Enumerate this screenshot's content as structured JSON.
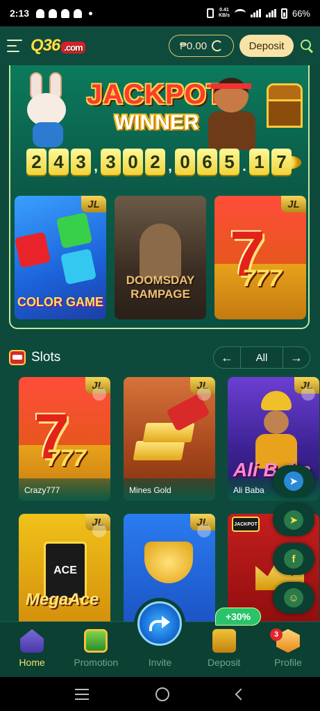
{
  "status_bar": {
    "time": "2:13",
    "net_speed_value": "0.41",
    "net_speed_unit": "KB/s",
    "battery": "66%"
  },
  "header": {
    "logo_main": "Q36",
    "logo_suffix": ".com",
    "balance": "₱0.00",
    "deposit_label": "Deposit"
  },
  "jackpot": {
    "title": "JACKPOT",
    "subtitle": "WINNER",
    "digits": [
      "2",
      "4",
      "3",
      ",",
      "3",
      "0",
      "2",
      ",",
      "0",
      "6",
      "5",
      ".",
      "1",
      "7"
    ],
    "games": [
      {
        "label": "COLOR GAME",
        "badge": "JL"
      },
      {
        "label": "DOOMSDAY RAMPAGE",
        "badge": "JL"
      },
      {
        "label": "777",
        "badge": "JL"
      }
    ]
  },
  "slots": {
    "title": "Slots",
    "filter_value": "All",
    "games": [
      {
        "name": "Crazy777",
        "badge": "JL"
      },
      {
        "name": "Mines Gold",
        "badge": "JL"
      },
      {
        "name": "Ali Baba",
        "badge": "JL",
        "art_text": "Ali Baba"
      },
      {
        "name": "",
        "badge": "JL",
        "art_text": "MegaAce",
        "card_text": "ACE"
      },
      {
        "name": "",
        "badge": "JL"
      },
      {
        "name": "",
        "badge": "",
        "art_text": "JACKPOT"
      }
    ]
  },
  "floating_buttons": [
    "telegram-icon",
    "telegram-icon",
    "facebook-icon",
    "support-icon"
  ],
  "bottom_nav": {
    "items": [
      {
        "label": "Home",
        "active": true
      },
      {
        "label": "Promotion"
      },
      {
        "label": "Invite"
      },
      {
        "label": "Deposit"
      },
      {
        "label": "Profile"
      }
    ],
    "deposit_bonus": "+30%",
    "profile_badge": "3"
  },
  "colors": {
    "background": "#0e4a3c",
    "accent_gold": "#f3e36a",
    "deposit_button": "#f8e2a6",
    "inactive_nav": "#6aa88f"
  }
}
